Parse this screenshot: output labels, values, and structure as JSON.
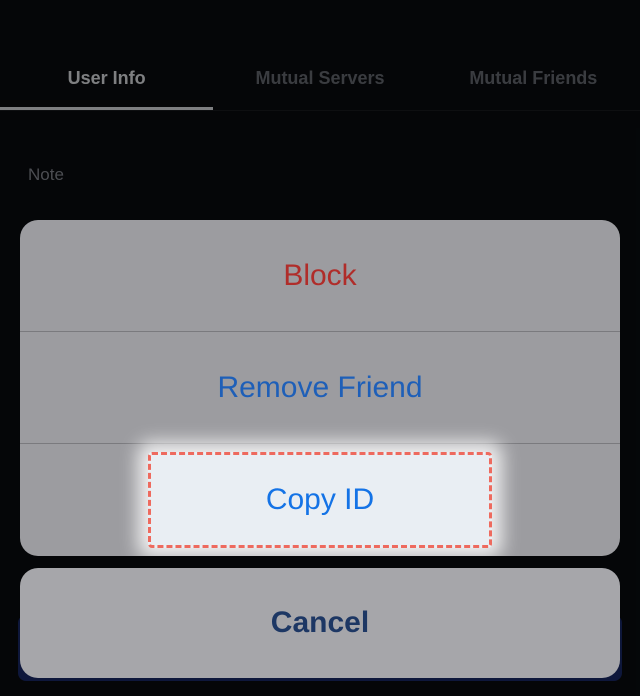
{
  "tabs": {
    "user_info": "User Info",
    "mutual_servers": "Mutual Servers",
    "mutual_friends": "Mutual Friends"
  },
  "note": {
    "label": "Note"
  },
  "sheet": {
    "block": "Block",
    "remove_friend": "Remove Friend",
    "copy_id": "Copy ID",
    "cancel": "Cancel"
  }
}
